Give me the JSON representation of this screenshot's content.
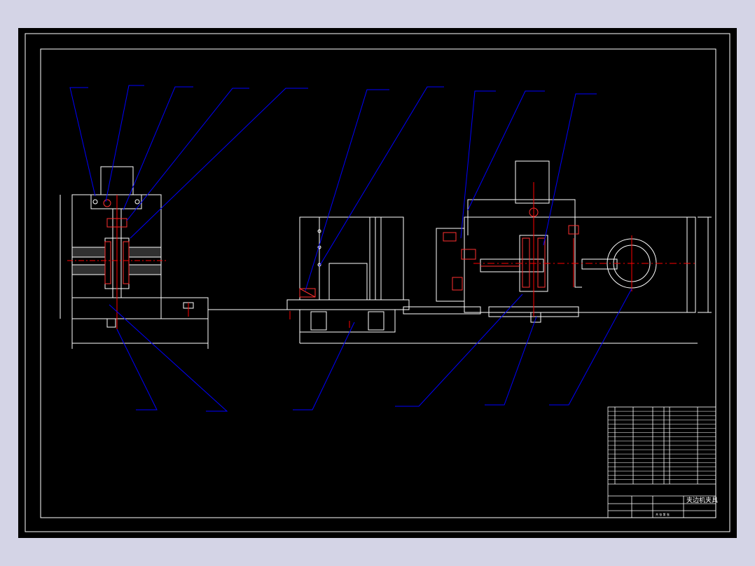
{
  "colors": {
    "background": "#d4d4e6",
    "sheet": "#000000",
    "border": "#ffffff",
    "outline": "#ffffff",
    "leader": "#0000ff",
    "hatch": "#ff3030",
    "centerline": "#ff0000"
  },
  "title_block": {
    "title": "夹边机夹具",
    "sub_row": "共 张  第  张"
  }
}
